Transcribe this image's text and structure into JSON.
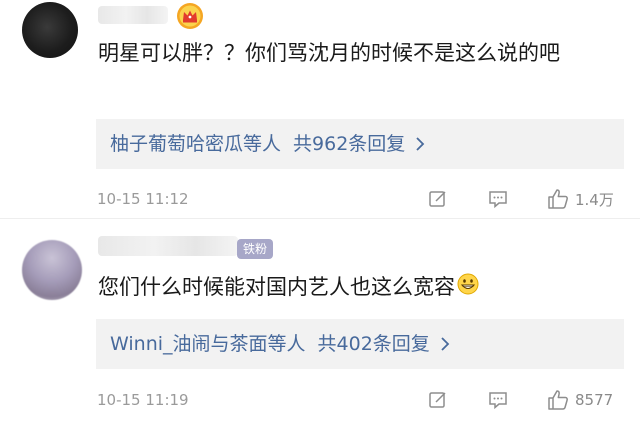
{
  "comments": [
    {
      "text": "明星可以胖？？你们骂沈月的时候不是这么说的吧",
      "replies_users": "柚子葡萄哈密瓜等人",
      "replies_count": "共962条回复",
      "timestamp": "10-15 11:12",
      "likes": "1.4万",
      "badge": "vip-crown"
    },
    {
      "text": "您们什么时候能对国内艺人也这么宽容",
      "fan_badge": "铁粉",
      "replies_users": "Winni_油闹与茶面等人",
      "replies_count": "共402条回复",
      "timestamp": "10-15 11:19",
      "likes": "8577",
      "emoji": "grinning-face"
    }
  ],
  "colors": {
    "link_blue": "#486a9c",
    "reply_bg": "#f2f2f2",
    "meta_gray": "#9a9a9a",
    "fan_badge_bg": "#a7a7c8"
  },
  "icons": [
    "edit-icon",
    "comment-icon",
    "like-icon",
    "chevron-right-icon",
    "vip-crown-icon"
  ]
}
